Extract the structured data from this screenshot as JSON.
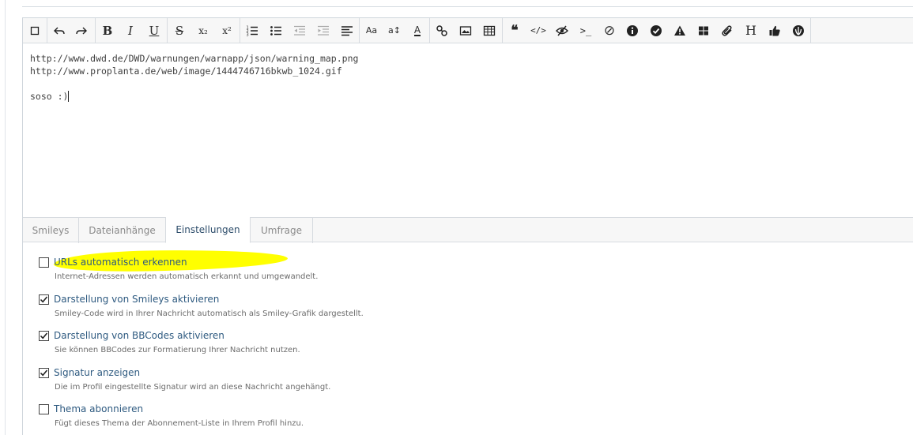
{
  "toolbar": {
    "buttons": [
      {
        "name": "select-all-icon"
      },
      {
        "name": "undo-icon"
      },
      {
        "name": "redo-icon"
      },
      {
        "name": "bold-icon",
        "glyph": "B"
      },
      {
        "name": "italic-icon",
        "glyph": "I"
      },
      {
        "name": "underline-icon",
        "glyph": "U"
      },
      {
        "name": "strikethrough-icon",
        "glyph": "S"
      },
      {
        "name": "subscript-icon",
        "glyph": "x₂"
      },
      {
        "name": "superscript-icon",
        "glyph": "x²"
      },
      {
        "name": "ordered-list-icon"
      },
      {
        "name": "unordered-list-icon"
      },
      {
        "name": "outdent-icon"
      },
      {
        "name": "indent-icon"
      },
      {
        "name": "align-icon"
      },
      {
        "name": "font-family-icon",
        "glyph": "Aa"
      },
      {
        "name": "font-size-icon",
        "glyph": "a↕"
      },
      {
        "name": "font-color-icon",
        "glyph": "A"
      },
      {
        "name": "link-icon"
      },
      {
        "name": "image-icon"
      },
      {
        "name": "table-icon"
      },
      {
        "name": "quote-icon",
        "glyph": "❝"
      },
      {
        "name": "code-icon",
        "glyph": "</>"
      },
      {
        "name": "spoiler-icon"
      },
      {
        "name": "terminal-icon",
        "glyph": ">_"
      },
      {
        "name": "no-parse-icon",
        "glyph": "⊘"
      },
      {
        "name": "info-icon",
        "glyph": "ℹ"
      },
      {
        "name": "success-icon",
        "glyph": "✔"
      },
      {
        "name": "warning-icon",
        "glyph": "▲"
      },
      {
        "name": "media-icon"
      },
      {
        "name": "attachment-icon"
      },
      {
        "name": "heading-icon",
        "glyph": "H"
      },
      {
        "name": "thumbs-up-icon"
      },
      {
        "name": "rebel-icon"
      }
    ]
  },
  "editor": {
    "lines": [
      "http://www.dwd.de/DWD/warnungen/warnapp/json/warning_map.png",
      "http://www.proplanta.de/web/image/1444746716bkwb_1024.gif",
      "",
      "soso :)"
    ]
  },
  "tabs": [
    {
      "label": "Smileys",
      "active": false
    },
    {
      "label": "Dateianhänge",
      "active": false
    },
    {
      "label": "Einstellungen",
      "active": true
    },
    {
      "label": "Umfrage",
      "active": false
    }
  ],
  "settings": {
    "options": [
      {
        "label": "URLs automatisch erkennen",
        "description": "Internet-Adressen werden automatisch erkannt und umgewandelt.",
        "checked": false,
        "highlighted": true
      },
      {
        "label": "Darstellung von Smileys aktivieren",
        "description": "Smiley-Code wird in Ihrer Nachricht automatisch als Smiley-Grafik dargestellt.",
        "checked": true
      },
      {
        "label": "Darstellung von BBCodes aktivieren",
        "description": "Sie können BBCodes zur Formatierung Ihrer Nachricht nutzen.",
        "checked": true
      },
      {
        "label": "Signatur anzeigen",
        "description": "Die im Profil eingestellte Signatur wird an diese Nachricht angehängt.",
        "checked": true
      },
      {
        "label": "Thema abonnieren",
        "description": "Fügt dieses Thema der Abonnement-Liste in Ihrem Profil hinzu.",
        "checked": false
      }
    ]
  },
  "colors": {
    "highlight": "#ffff00",
    "label_link": "#2e5a80",
    "tab_active_text": "#2c4c6a"
  }
}
